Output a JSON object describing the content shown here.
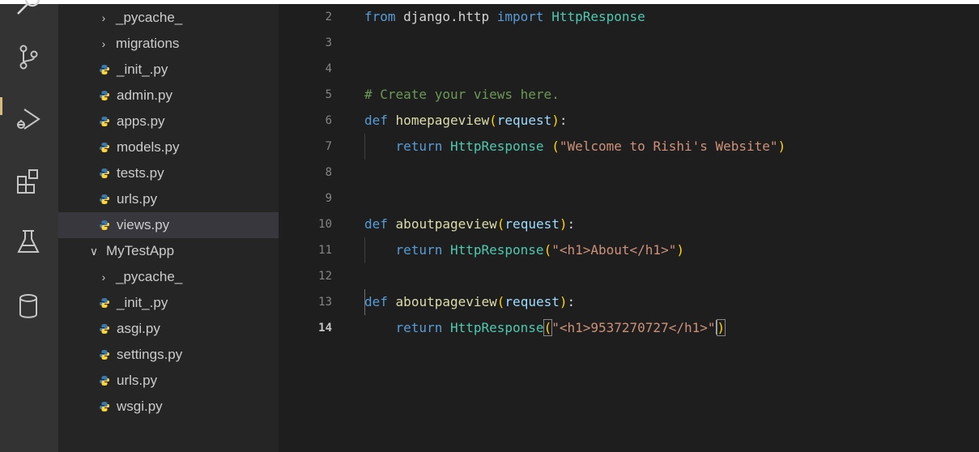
{
  "explorer": {
    "items": [
      {
        "label": "_pycache_",
        "type": "folder",
        "expanded": false
      },
      {
        "label": "migrations",
        "type": "folder",
        "expanded": false
      },
      {
        "label": "_init_.py",
        "type": "file"
      },
      {
        "label": "admin.py",
        "type": "file"
      },
      {
        "label": "apps.py",
        "type": "file"
      },
      {
        "label": "models.py",
        "type": "file"
      },
      {
        "label": "tests.py",
        "type": "file"
      },
      {
        "label": "urls.py",
        "type": "file"
      },
      {
        "label": "views.py",
        "type": "file",
        "selected": true
      },
      {
        "label": "MyTestApp",
        "type": "folder",
        "expanded": true
      },
      {
        "label": "_pycache_",
        "type": "folder",
        "expanded": false
      },
      {
        "label": "_init_.py",
        "type": "file"
      },
      {
        "label": "asgi.py",
        "type": "file"
      },
      {
        "label": "settings.py",
        "type": "file"
      },
      {
        "label": "urls.py",
        "type": "file"
      },
      {
        "label": "wsgi.py",
        "type": "file"
      }
    ]
  },
  "activity_bar": {
    "icons": [
      "search-icon",
      "source-control-icon",
      "run-debug-icon",
      "extensions-icon",
      "testing-icon",
      "database-icon"
    ]
  },
  "editor": {
    "active_line": 14,
    "lines": [
      {
        "n": "2",
        "tokens": [
          [
            "k",
            "from"
          ],
          [
            "w",
            " django.http "
          ],
          [
            "k",
            "import"
          ],
          [
            "t",
            " HttpResponse"
          ]
        ]
      },
      {
        "n": "3",
        "tokens": []
      },
      {
        "n": "4",
        "tokens": []
      },
      {
        "n": "5",
        "tokens": [
          [
            "c",
            "# Create your views here."
          ]
        ]
      },
      {
        "n": "6",
        "tokens": [
          [
            "k",
            "def"
          ],
          [
            "w",
            " "
          ],
          [
            "f",
            "homepageview"
          ],
          [
            "y",
            "("
          ],
          [
            "p",
            "request"
          ],
          [
            "y",
            ")"
          ],
          [
            "w",
            ":"
          ]
        ]
      },
      {
        "n": "7",
        "tokens": [
          [
            "w",
            "    "
          ],
          [
            "k",
            "return"
          ],
          [
            "w",
            " "
          ],
          [
            "t",
            "HttpResponse"
          ],
          [
            "w",
            " "
          ],
          [
            "y",
            "("
          ],
          [
            "s",
            "\"Welcome to Rishi's Website\""
          ],
          [
            "y",
            ")"
          ]
        ]
      },
      {
        "n": "8",
        "tokens": []
      },
      {
        "n": "9",
        "tokens": []
      },
      {
        "n": "10",
        "tokens": [
          [
            "k",
            "def"
          ],
          [
            "w",
            " "
          ],
          [
            "f",
            "aboutpageview"
          ],
          [
            "y",
            "("
          ],
          [
            "p",
            "request"
          ],
          [
            "y",
            ")"
          ],
          [
            "w",
            ":"
          ]
        ]
      },
      {
        "n": "11",
        "tokens": [
          [
            "w",
            "    "
          ],
          [
            "k",
            "return"
          ],
          [
            "w",
            " "
          ],
          [
            "t",
            "HttpResponse"
          ],
          [
            "y",
            "("
          ],
          [
            "s",
            "\"<h1>About</h1>\""
          ],
          [
            "y",
            ")"
          ]
        ]
      },
      {
        "n": "12",
        "tokens": []
      },
      {
        "n": "13",
        "tokens": [
          [
            "k",
            "def"
          ],
          [
            "w",
            " "
          ],
          [
            "f",
            "aboutpageview"
          ],
          [
            "y",
            "("
          ],
          [
            "p",
            "request"
          ],
          [
            "y",
            ")"
          ],
          [
            "w",
            ":"
          ]
        ]
      },
      {
        "n": "14",
        "tokens": [
          [
            "w",
            "    "
          ],
          [
            "k",
            "return"
          ],
          [
            "w",
            " "
          ],
          [
            "t",
            "HttpResponse"
          ],
          [
            "y bm",
            "("
          ],
          [
            "s",
            "\"<h1>9537270727</h1>\""
          ],
          [
            "y bm",
            ")"
          ]
        ]
      }
    ]
  },
  "colors": {
    "activity_bar": "#333333",
    "sidebar": "#252526",
    "editor": "#1e1e1e",
    "selected_item": "#37373d",
    "python_icon_blue": "#3c78aa",
    "python_icon_yellow": "#ffd43b"
  }
}
